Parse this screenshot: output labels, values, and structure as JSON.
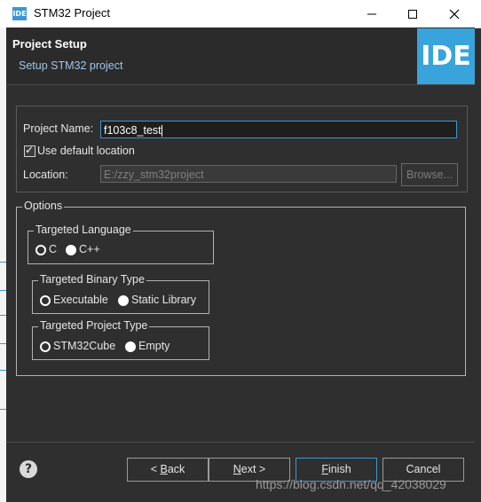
{
  "window": {
    "logo_text": "IDE",
    "title": "STM32 Project",
    "controls": {
      "minimize": "—",
      "maximize": "☐",
      "close": "✕"
    }
  },
  "header": {
    "title": "Project Setup",
    "subtitle": "Setup STM32 project",
    "badge": "IDE"
  },
  "project": {
    "name_label": "Project Name:",
    "name_value": "f103c8_test",
    "use_default_label": "Use default location",
    "use_default_checked": true,
    "location_label": "Location:",
    "location_value": "E:/zzy_stm32project",
    "browse_label": "Browse..."
  },
  "options": {
    "title": "Options",
    "language": {
      "title": "Targeted Language",
      "choices": [
        "C",
        "C++"
      ],
      "selected": "C"
    },
    "binary": {
      "title": "Targeted Binary Type",
      "choices": [
        "Executable",
        "Static Library"
      ],
      "selected": "Executable"
    },
    "project_type": {
      "title": "Targeted Project Type",
      "choices": [
        "STM32Cube",
        "Empty"
      ],
      "selected": "STM32Cube"
    }
  },
  "footer": {
    "help_icon": "?",
    "back": {
      "pre": "< ",
      "key": "B",
      "post": "ack"
    },
    "next": {
      "key": "N",
      "post": "ext >"
    },
    "finish": {
      "key": "F",
      "post": "inish"
    },
    "cancel": "Cancel"
  },
  "watermark": "https://blog.csdn.net/qq_42038029",
  "colors": {
    "accent": "#39a3db",
    "background": "#2f2f2f"
  }
}
